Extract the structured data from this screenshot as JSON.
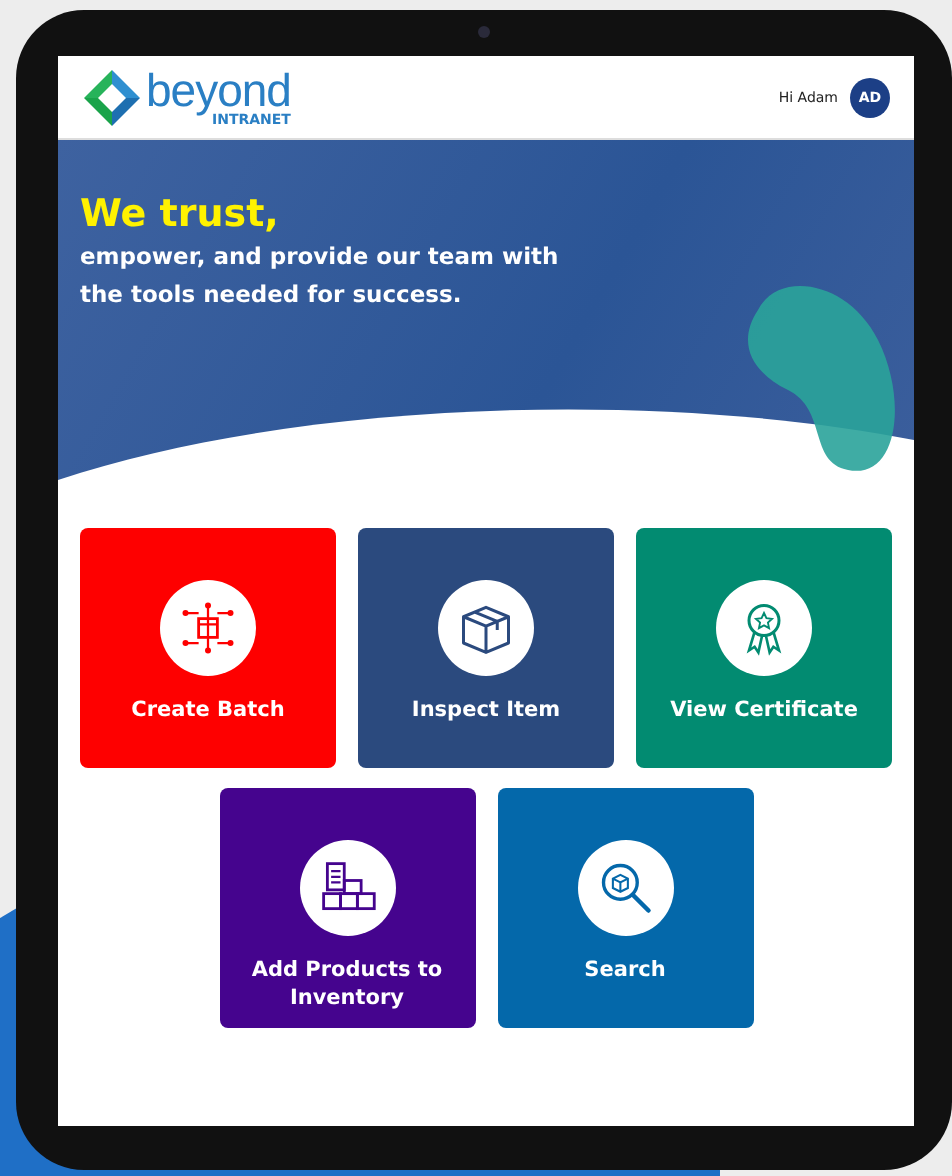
{
  "header": {
    "logo_word": "beyond",
    "logo_sub": "INTRANET",
    "greeting": "Hi Adam",
    "avatar": "AD"
  },
  "hero": {
    "headline": "We trust,",
    "tagline": "empower, and provide our team with the tools needed for success."
  },
  "tiles": [
    {
      "label": "Create Batch",
      "color": "#fe0000",
      "kind": "network"
    },
    {
      "label": "Inspect Item",
      "color": "#2b4a7e",
      "kind": "box"
    },
    {
      "label": "View Certificate",
      "color": "#028b71",
      "kind": "award"
    },
    {
      "label": "Add Products to Inventory",
      "color": "#45048e",
      "kind": "inventory"
    },
    {
      "label": "Search",
      "color": "#0468aa",
      "kind": "search"
    }
  ]
}
